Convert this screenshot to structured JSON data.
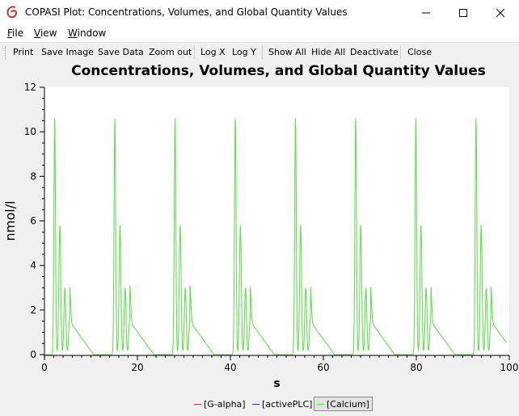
{
  "window": {
    "title": "COPASI Plot: Concentrations, Volumes, and Global Quantity Values",
    "app_icon": "copasi-logo-icon",
    "controls": {
      "minimize": "minimize-icon",
      "maximize": "maximize-icon",
      "close": "close-icon"
    }
  },
  "menu": {
    "items": [
      {
        "label": "File",
        "mnemonic": "F"
      },
      {
        "label": "View",
        "mnemonic": "V"
      },
      {
        "label": "Window",
        "mnemonic": "W"
      }
    ]
  },
  "toolbar": {
    "buttons": [
      "Print",
      "Save Image",
      "Save Data",
      "Zoom out",
      "Log X",
      "Log Y",
      "Show All",
      "Hide All",
      "Deactivate",
      "Close"
    ]
  },
  "chart_data": {
    "type": "line",
    "title": "Concentrations, Volumes, and Global Quantity Values",
    "xlabel": "s",
    "ylabel": "nmol/l",
    "xlim": [
      0,
      100
    ],
    "ylim": [
      0,
      12
    ],
    "x_ticks": [
      0,
      20,
      40,
      60,
      80,
      100
    ],
    "y_ticks": [
      0,
      2,
      4,
      6,
      8,
      10,
      12
    ],
    "grid": false,
    "legend_position": "bottom",
    "series": [
      {
        "name": "[G-alpha]",
        "color": "#cc3333",
        "visible": false,
        "values": []
      },
      {
        "name": "[activePLC]",
        "color": "#3333cc",
        "visible": false,
        "values": []
      },
      {
        "name": "[Calcium]",
        "color": "#66dd55",
        "visible": true,
        "period": 12.95,
        "first_spike_x": 2.2,
        "spike_peaks": [
          {
            "dx": 0.0,
            "y": 10.6
          },
          {
            "dx": 1.1,
            "y": 5.8
          },
          {
            "dx": 2.2,
            "y": 3.0
          },
          {
            "dx": 3.2,
            "y": 1.6
          }
        ],
        "baseline": 0.0
      }
    ]
  },
  "legend": {
    "items": [
      {
        "label": "[G-alpha]",
        "color": "#cc3333",
        "selected": false
      },
      {
        "label": "[activePLC]",
        "color": "#3333cc",
        "selected": false
      },
      {
        "label": "[Calcium]",
        "color": "#66dd55",
        "selected": true
      }
    ]
  }
}
